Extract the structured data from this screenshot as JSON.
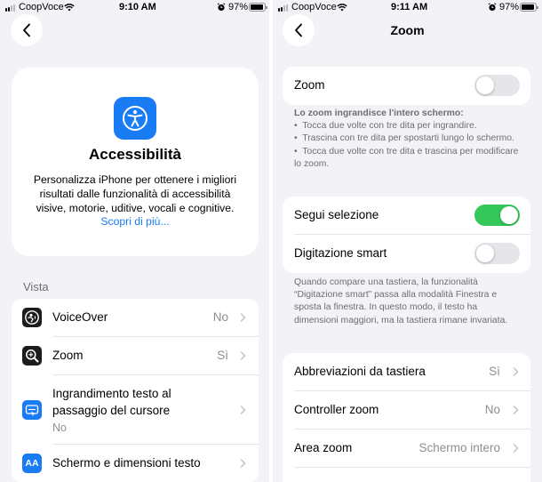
{
  "left": {
    "status": {
      "carrier": "CoopVoce",
      "time": "9:10 AM",
      "battery": "97%"
    },
    "hero": {
      "title": "Accessibilità",
      "description": "Personalizza iPhone per ottenere i migliori risultati dalle funzionalità di accessibilità visive, motorie, uditive, vocali e cognitive.",
      "link": "Scopri di più..."
    },
    "section_title": "Vista",
    "items": [
      {
        "label": "VoiceOver",
        "value": "No",
        "icon": "voiceover-icon"
      },
      {
        "label": "Zoom",
        "value": "Sì",
        "icon": "zoom-icon"
      },
      {
        "label_line1": "Ingrandimento testo al",
        "label_line2": "passaggio del cursore",
        "value": "No",
        "icon": "hover-text-icon"
      },
      {
        "label": "Schermo e dimensioni testo",
        "icon": "text-size-icon",
        "icon_text": "AA"
      }
    ]
  },
  "right": {
    "status": {
      "carrier": "CoopVoce",
      "time": "9:11 AM",
      "battery": "97%"
    },
    "title": "Zoom",
    "zoom_toggle": {
      "label": "Zoom",
      "on": false
    },
    "zoom_footer": {
      "heading": "Lo zoom ingrandisce l'intero schermo:",
      "bullets": [
        "Tocca due volte con tre dita per ingrandire.",
        "Trascina con tre dita per spostarti lungo lo schermo.",
        "Tocca due volte con tre dita e trascina per modificare lo zoom."
      ]
    },
    "follow_focus": {
      "label": "Segui selezione",
      "on": true
    },
    "smart_typing": {
      "label": "Digitazione smart",
      "on": false
    },
    "typing_footer": "Quando compare una tastiera, la funzionalità “Digitazione smart” passa alla modalità Finestra e sposta la finestra. In questo modo, il testo ha dimensioni maggiori, ma la tastiera rimane invariata.",
    "items": [
      {
        "label": "Abbreviazioni da tastiera",
        "value": "Sì"
      },
      {
        "label": "Controller zoom",
        "value": "No"
      },
      {
        "label": "Area zoom",
        "value": "Schermo intero"
      }
    ]
  },
  "colors": {
    "accent": "#1a7cf5",
    "toggle_on": "#34c759",
    "background": "#f2f2f7"
  }
}
